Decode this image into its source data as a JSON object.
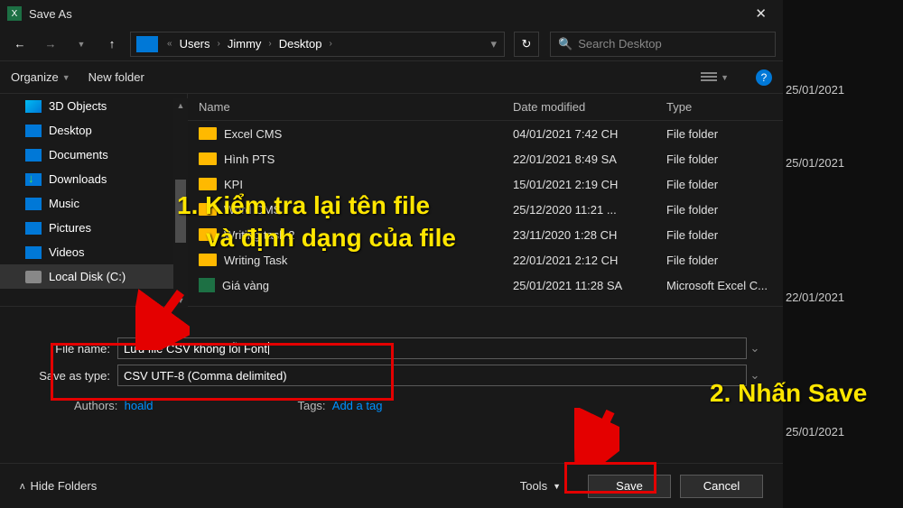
{
  "title": "Save As",
  "nav": {
    "crumbs": [
      "Users",
      "Jimmy",
      "Desktop"
    ],
    "search_placeholder": "Search Desktop"
  },
  "toolbar": {
    "organize": "Organize",
    "new_folder": "New folder"
  },
  "sidebar": {
    "items": [
      {
        "label": "3D Objects",
        "icon": "ico-3d"
      },
      {
        "label": "Desktop",
        "icon": "ico-desk"
      },
      {
        "label": "Documents",
        "icon": "ico-docs"
      },
      {
        "label": "Downloads",
        "icon": "ico-down"
      },
      {
        "label": "Music",
        "icon": "ico-music"
      },
      {
        "label": "Pictures",
        "icon": "ico-pics"
      },
      {
        "label": "Videos",
        "icon": "ico-vids"
      },
      {
        "label": "Local Disk (C:)",
        "icon": "ico-disk"
      }
    ]
  },
  "columns": {
    "name": "Name",
    "date": "Date modified",
    "type": "Type"
  },
  "files": [
    {
      "name": "Excel CMS",
      "date": "04/01/2021 7:42 CH",
      "type": "File folder",
      "icon": "ico-folder"
    },
    {
      "name": "Hình PTS",
      "date": "22/01/2021 8:49 SA",
      "type": "File folder",
      "icon": "ico-folder"
    },
    {
      "name": "KPI",
      "date": "15/01/2021 2:19 CH",
      "type": "File folder",
      "icon": "ico-folder"
    },
    {
      "name": "Word CMS",
      "date": "25/12/2020 11:21 ...",
      "type": "File folder",
      "icon": "ico-folder"
    },
    {
      "name": "Writing task 2",
      "date": "23/11/2020 1:28 CH",
      "type": "File folder",
      "icon": "ico-folder"
    },
    {
      "name": "Writing Task",
      "date": "22/01/2021 2:12 CH",
      "type": "File folder",
      "icon": "ico-folder"
    },
    {
      "name": "Giá vàng",
      "date": "25/01/2021 11:28 SA",
      "type": "Microsoft Excel C...",
      "icon": "ico-xls"
    }
  ],
  "form": {
    "file_name_label": "File name:",
    "file_name_value": "Lưu file CSV không lỗi Font",
    "save_type_label": "Save as type:",
    "save_type_value": "CSV UTF-8 (Comma delimited)",
    "authors_label": "Authors:",
    "authors_value": "hoald",
    "tags_label": "Tags:",
    "tags_value": "Add a tag"
  },
  "footer": {
    "hide_folders": "Hide Folders",
    "tools": "Tools",
    "save": "Save",
    "cancel": "Cancel"
  },
  "annotations": {
    "step1": "1. Kiểm tra lại tên file\n   và định dạng của file",
    "step1_line1": "1. Kiểm tra lại tên file",
    "step1_line2": "và định dạng của file",
    "step2": "2. Nhấn Save"
  },
  "backdrop_dates": [
    "25/01/2021",
    "25/01/2021",
    "22/01/2021",
    "25/01/2021"
  ]
}
